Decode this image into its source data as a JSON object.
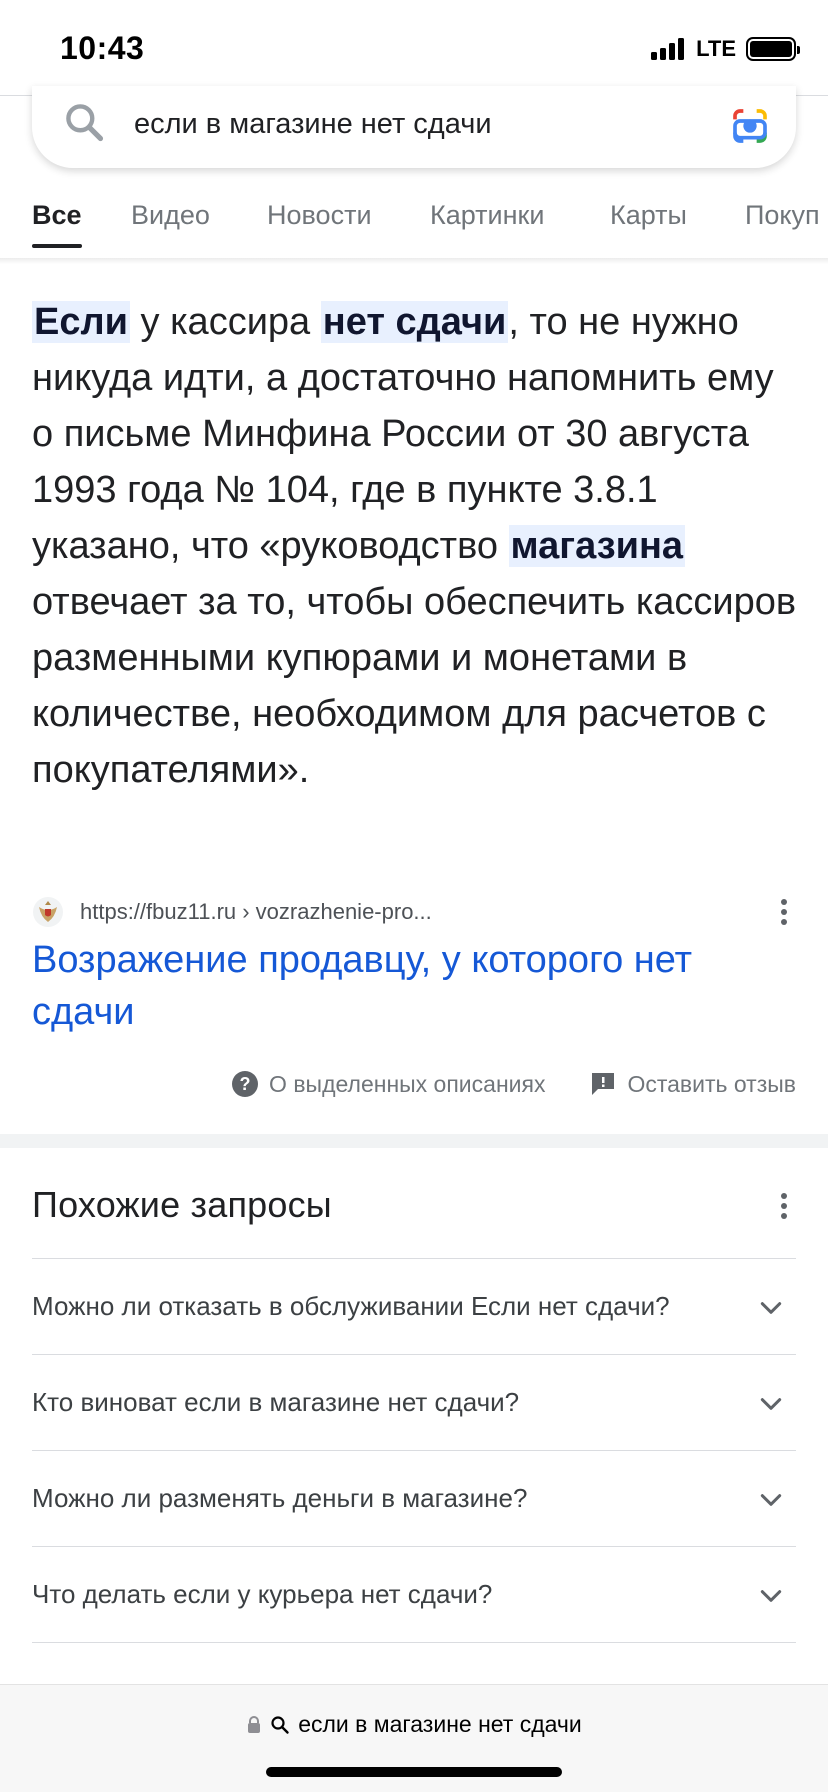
{
  "status_bar": {
    "time": "10:43",
    "network": "LTE"
  },
  "search": {
    "query": "если в магазине нет сдачи",
    "icon": "search-icon",
    "lens_icon": "google-lens-icon"
  },
  "tabs": [
    {
      "label": "Все",
      "active": true
    },
    {
      "label": "Видео",
      "active": false
    },
    {
      "label": "Новости",
      "active": false
    },
    {
      "label": "Картинки",
      "active": false
    },
    {
      "label": "Карты",
      "active": false
    },
    {
      "label": "Покуп",
      "active": false
    }
  ],
  "snippet": {
    "parts": [
      {
        "text": "Если",
        "highlight": true
      },
      {
        "text": " у кассира ",
        "highlight": false
      },
      {
        "text": "нет сдачи",
        "highlight": true
      },
      {
        "text": ", то не нужно никуда идти, а достаточно напомнить ему о письме Минфина России от 30 августа 1993 года № 104, где в пункте 3.8.1 указано, что «руководство ",
        "highlight": false
      },
      {
        "text": "магазина",
        "highlight": true
      },
      {
        "text": " отвечает за то, чтобы обеспечить кассиров разменными купюрами и монетами в количестве, необходимом для расчетов с покупателями».",
        "highlight": false
      }
    ],
    "source_url": "https://fbuz11.ru › vozrazhenie-pro...",
    "result_title": "Возражение продавцу, у которого нет сдачи"
  },
  "feedback": {
    "about_label": "О выделенных описаниях",
    "feedback_label": "Оставить отзыв"
  },
  "related": {
    "title": "Похожие запросы",
    "items": [
      "Можно ли отказать в обслуживании Если нет сдачи?",
      "Кто виноват если в магазине нет сдачи?",
      "Можно ли разменять деньги в магазине?",
      "Что делать если у курьера нет сдачи?"
    ]
  },
  "bottom_bar": {
    "address": "если в магазине нет сдачи"
  },
  "colors": {
    "link": "#1558d6",
    "highlight_bg": "#e8f0fe",
    "text": "#202124",
    "muted": "#70757a"
  }
}
